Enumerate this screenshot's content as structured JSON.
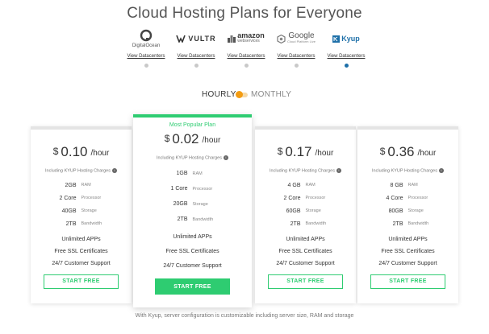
{
  "title": "Cloud Hosting Plans for Everyone",
  "providers": [
    {
      "name": "DigitalOcean",
      "link": "View Datacenters",
      "active": false
    },
    {
      "name": "VULTR",
      "link": "View Datacenters",
      "active": false
    },
    {
      "name": "amazon",
      "sub": "webservices",
      "link": "View Datacenters",
      "active": false
    },
    {
      "name": "Google",
      "sub": "Cloud Platform Live",
      "link": "View Datacenters",
      "active": false
    },
    {
      "name": "Kyup",
      "link": "View Datacenters",
      "active": true
    }
  ],
  "billing": {
    "hourly": "HOURLY",
    "monthly": "MONTHLY",
    "selected": "hourly"
  },
  "plans": [
    {
      "featured": false,
      "currency": "$",
      "price": "0.10",
      "period": "/hour",
      "charges": "Including KYUP Hosting Charges",
      "specs": [
        {
          "value": "2GB",
          "unit": "RAM"
        },
        {
          "value": "2 Core",
          "unit": "Processor"
        },
        {
          "value": "40GB",
          "unit": "Storage"
        },
        {
          "value": "2TB",
          "unit": "Bandwidth"
        }
      ],
      "features": [
        "Unlimited APPs",
        "Free SSL Certificates",
        "24/7 Customer Support"
      ],
      "cta": "START FREE"
    },
    {
      "featured": true,
      "badge": "Most Popular Plan",
      "currency": "$",
      "price": "0.02",
      "period": "/hour",
      "charges": "Including KYUP Hosting Charges",
      "specs": [
        {
          "value": "1GB",
          "unit": "RAM"
        },
        {
          "value": "1 Core",
          "unit": "Processor"
        },
        {
          "value": "20GB",
          "unit": "Storage"
        },
        {
          "value": "2TB",
          "unit": "Bandwidth"
        }
      ],
      "features": [
        "Unlimited APPs",
        "Free SSL Certificates",
        "24/7 Customer Support"
      ],
      "cta": "START FREE"
    },
    {
      "featured": false,
      "currency": "$",
      "price": "0.17",
      "period": "/hour",
      "charges": "Including KYUP Hosting Charges",
      "specs": [
        {
          "value": "4 GB",
          "unit": "RAM"
        },
        {
          "value": "2 Core",
          "unit": "Processor"
        },
        {
          "value": "60GB",
          "unit": "Storage"
        },
        {
          "value": "2TB",
          "unit": "Bandwidth"
        }
      ],
      "features": [
        "Unlimited APPs",
        "Free SSL Certificates",
        "24/7 Customer Support"
      ],
      "cta": "START FREE"
    },
    {
      "featured": false,
      "currency": "$",
      "price": "0.36",
      "period": "/hour",
      "charges": "Including KYUP Hosting Charges",
      "specs": [
        {
          "value": "8 GB",
          "unit": "RAM"
        },
        {
          "value": "4 Core",
          "unit": "Processor"
        },
        {
          "value": "80GB",
          "unit": "Storage"
        },
        {
          "value": "2TB",
          "unit": "Bandwidth"
        }
      ],
      "features": [
        "Unlimited APPs",
        "Free SSL Certificates",
        "24/7 Customer Support"
      ],
      "cta": "START FREE"
    }
  ],
  "footnote": "With Kyup, server configuration is customizable including server size, RAM and storage",
  "colors": {
    "accent": "#2ecc71",
    "toggle": "#f39c12",
    "active_dot": "#1d6fa8"
  }
}
